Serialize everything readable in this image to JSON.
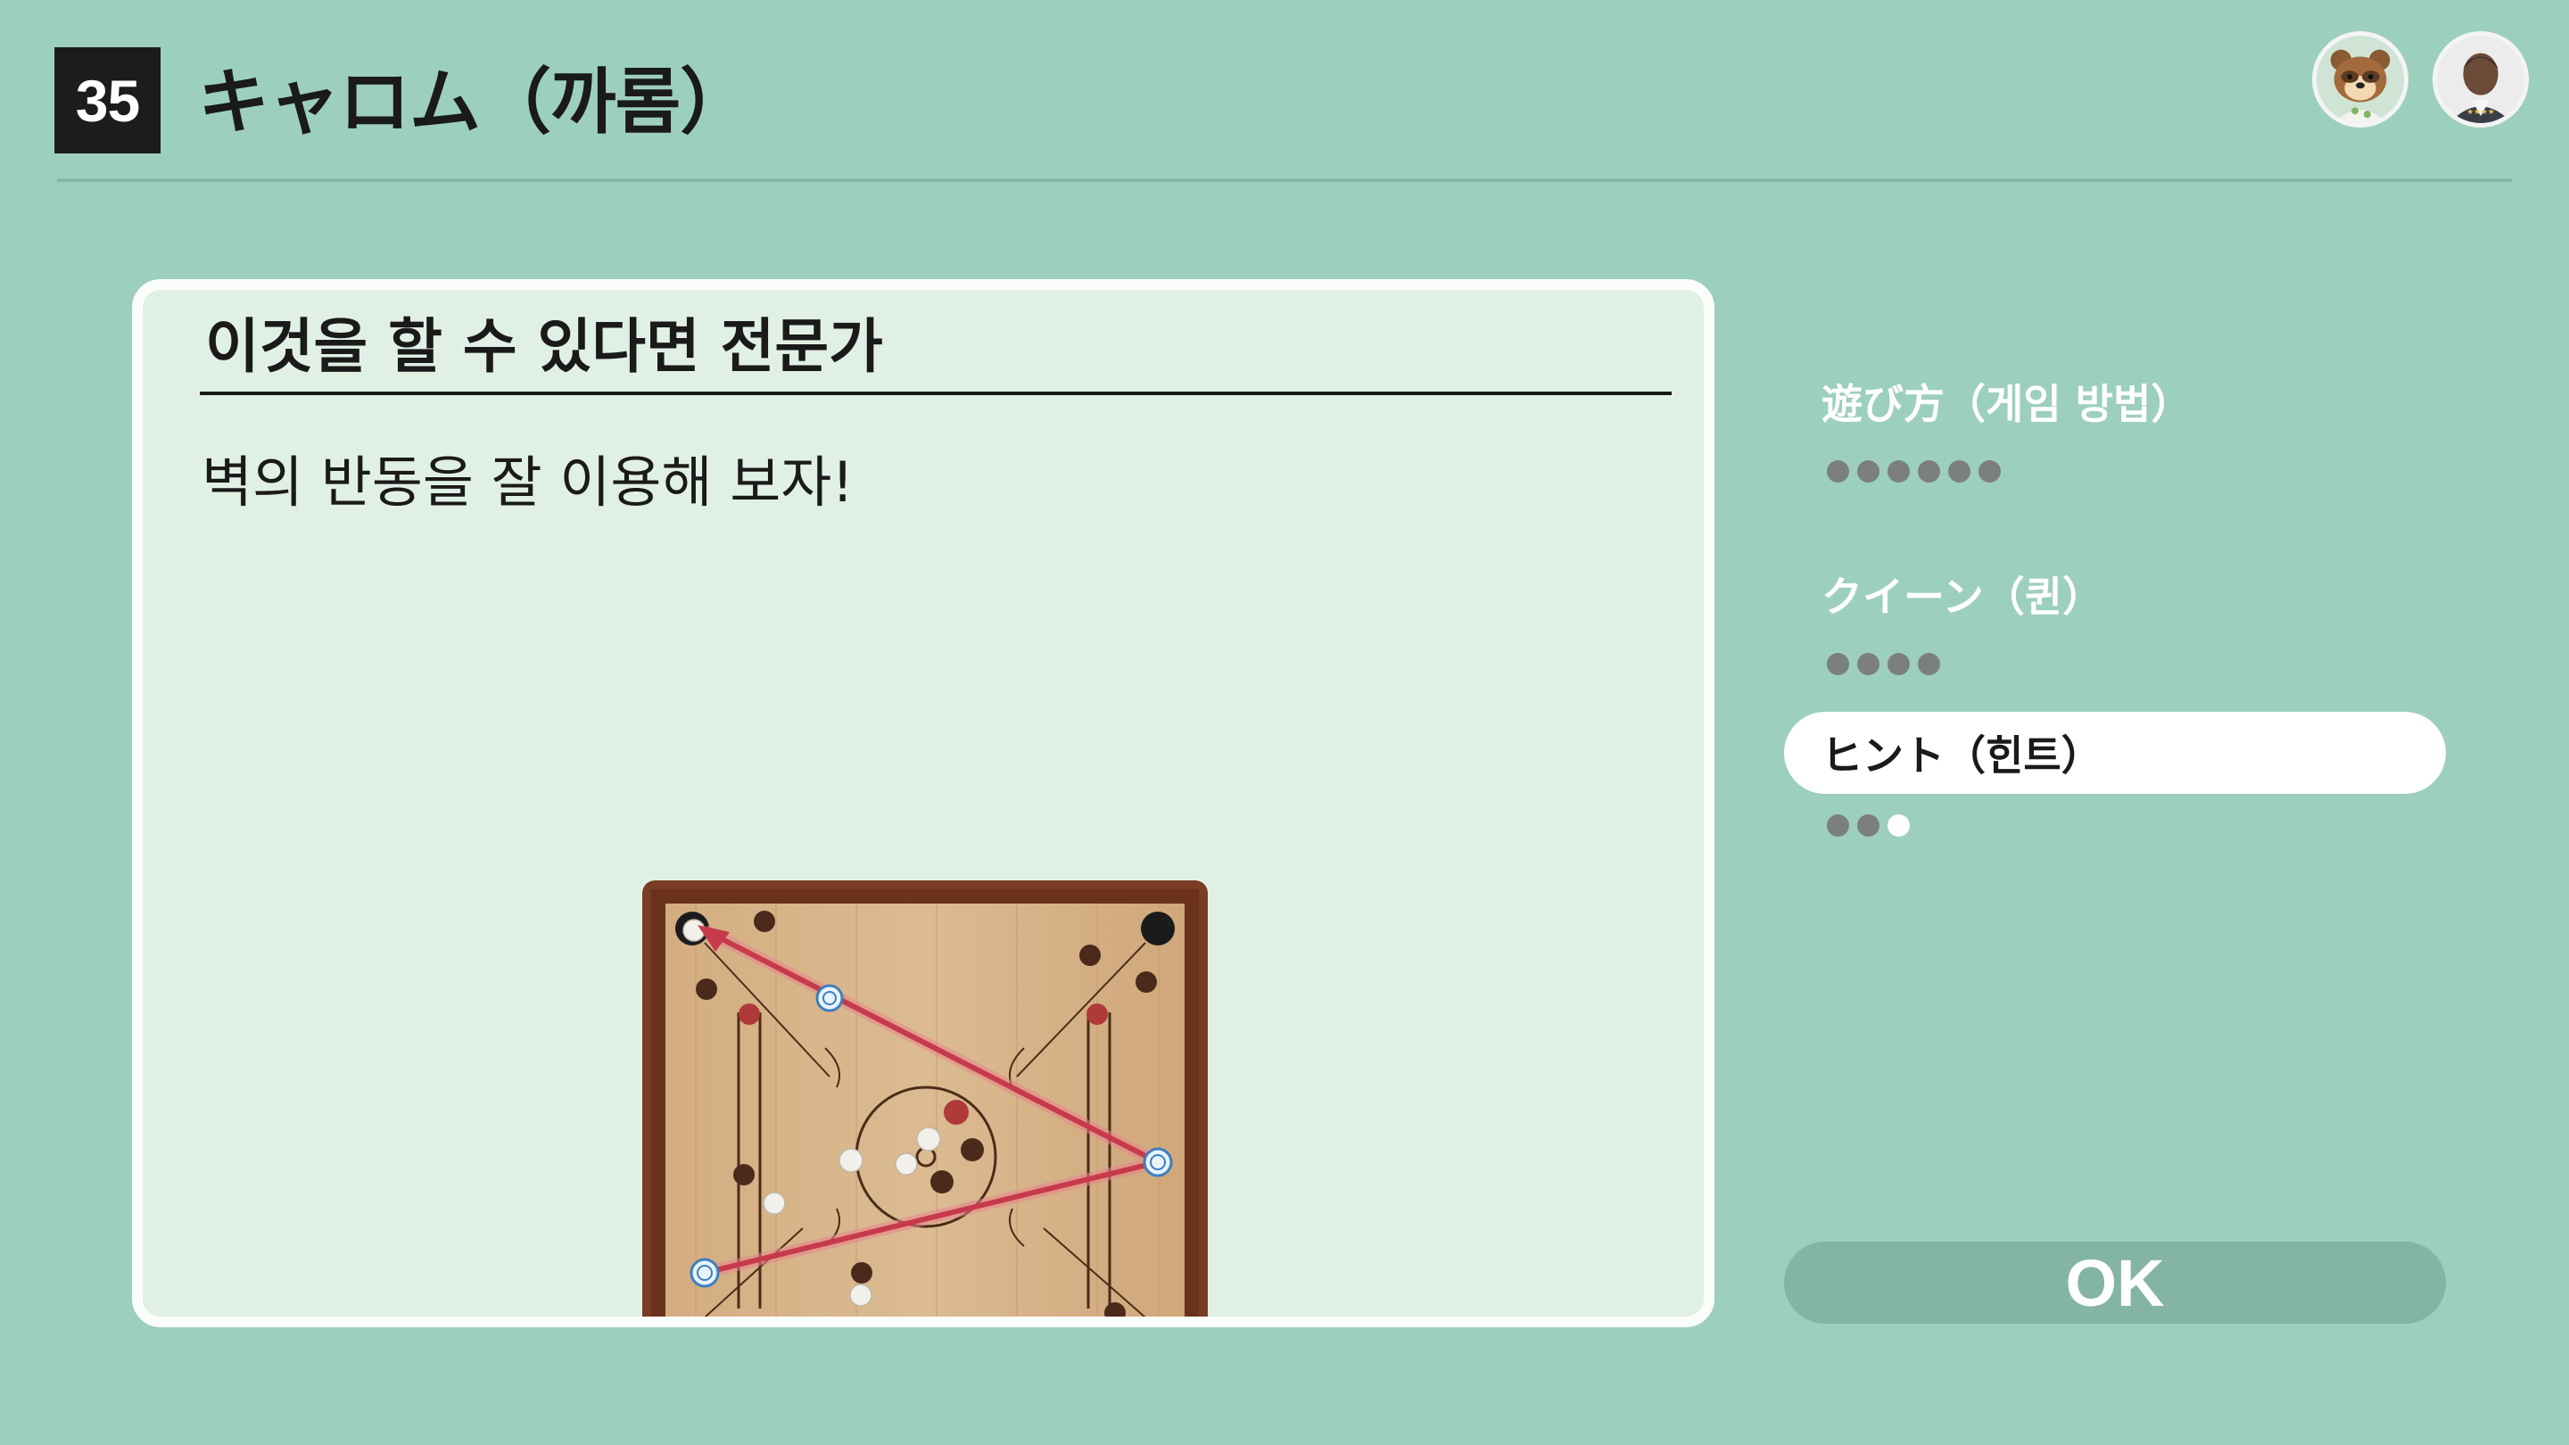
{
  "header": {
    "game_number": "35",
    "title": "キャロム（까롬）"
  },
  "players": [
    {
      "icon": "raccoon-character-icon"
    },
    {
      "icon": "player-avatar-icon"
    }
  ],
  "card": {
    "heading": "이것을 할 수 있다면 전문가",
    "body": "벽의 반동을 잘 이용해 보자!"
  },
  "menu": {
    "items": [
      {
        "label": "遊び方（게임 방법）",
        "pages_total": 6,
        "pages_highlighted": 0
      },
      {
        "label": "クイーン（퀸）",
        "pages_total": 4,
        "pages_highlighted": 0
      },
      {
        "label": "ヒント（힌트）",
        "pages_total": 3,
        "pages_highlighted": 1
      }
    ],
    "selected_index": 2
  },
  "ok_button": {
    "label": "OK"
  },
  "colors": {
    "background": "#9dcfbd",
    "card": "#e1f0e5",
    "board_wood": "#d8b58a",
    "board_frame": "#7a3c22",
    "shot_path": "#d24c5a"
  }
}
